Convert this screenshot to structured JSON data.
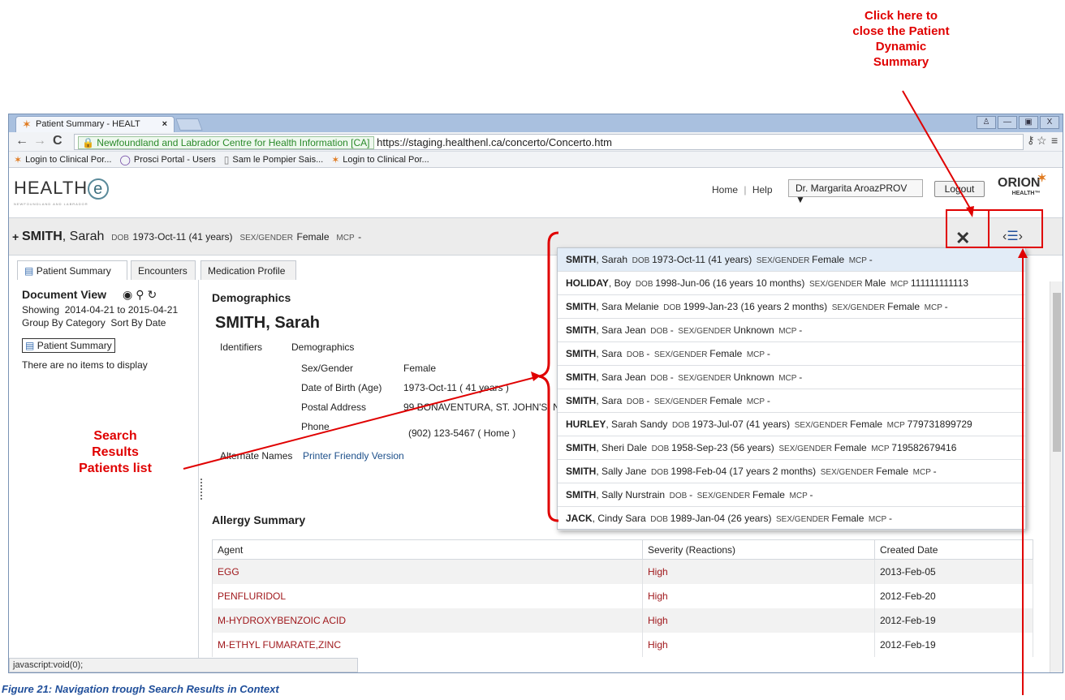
{
  "annotations": {
    "close_callout": "Click here to close the Patient Dynamic Summary",
    "close_callout_lines": [
      "Click here to",
      "close the Patient",
      "Dynamic",
      "Summary"
    ],
    "search_callout_lines": [
      "Search",
      "Results",
      "Patients list"
    ],
    "figure_caption": "Figure 21: Navigation trough Search Results in Context"
  },
  "browser": {
    "tab_title": "Patient Summary - HEALT",
    "tab_close": "×",
    "window_buttons": [
      "♙",
      "—",
      "▣",
      "X"
    ],
    "security_label": "Newfoundland and Labrador Centre for Health Information [CA]",
    "url": "https://staging.healthenl.ca/concerto/Concerto.htm",
    "bookmarks": [
      {
        "icon": "star-icon",
        "label": "Login to Clinical Por..."
      },
      {
        "icon": "circle-icon",
        "label": "Prosci Portal - Users"
      },
      {
        "icon": "page-icon",
        "label": "Sam le Pompier Sais..."
      },
      {
        "icon": "star-icon",
        "label": "Login to Clinical Por..."
      }
    ],
    "status_text": "javascript:void(0);"
  },
  "app": {
    "logo_text": "HEALTH",
    "logo_e": "e",
    "logo_sub": "NEWFOUNDLAND AND LABRADOR",
    "nav_home": "Home",
    "nav_sep": "|",
    "nav_help": "Help",
    "user": "Dr. Margarita AroazPROV ▼",
    "logout": "Logout",
    "orion": "ORION",
    "orion_sub": "HEALTH™"
  },
  "patient_bar": {
    "plus": "+",
    "surname": "SMITH",
    "given": ", Sarah",
    "dob_label": "DOB",
    "dob": "1973-Oct-11 (41 years)",
    "sex_label": "SEX/GENDER",
    "sex": "Female",
    "mcp_label": "MCP",
    "mcp": "-"
  },
  "tabs": [
    "Patient Summary",
    "Encounters",
    "Medication Profile"
  ],
  "sidebar": {
    "title": "Document View",
    "showing_label": "Showing",
    "showing_range": "2014-04-21 to 2015-04-21",
    "group_by_label": "Group By",
    "group_by": "Category",
    "sort_by_label": "Sort By",
    "sort_by": "Date",
    "selected_item": "Patient Summary",
    "empty_text": "There are no items to display"
  },
  "demographics": {
    "heading": "Demographics",
    "name": "SMITH, Sarah",
    "identifiers": "Identifiers",
    "demographics_col": "Demographics",
    "rows": [
      {
        "label": "Sex/Gender",
        "value": "Female"
      },
      {
        "label": "Date of Birth (Age)",
        "value": "1973-Oct-11 ( 41 years )"
      },
      {
        "label": "Postal Address",
        "value": "99 BONAVENTURA, ST. JOHN'S, NL"
      },
      {
        "label": "Phone",
        "value": "(902) 123-5467   ( Home )"
      }
    ],
    "alternate_names": "Alternate Names",
    "printer_friendly": "Printer Friendly Version"
  },
  "allergy": {
    "heading": "Allergy Summary",
    "columns": [
      "Agent",
      "Severity (Reactions)",
      "Created Date"
    ],
    "rows": [
      [
        "EGG",
        "High",
        "2013-Feb-05"
      ],
      [
        "PENFLURIDOL",
        "High",
        "2012-Feb-20"
      ],
      [
        "M-HYDROXYBENZOIC ACID",
        "High",
        "2012-Feb-19"
      ],
      [
        "M-ETHYL FUMARATE,ZINC",
        "High",
        "2012-Feb-19"
      ]
    ]
  },
  "search_results": [
    {
      "surname": "SMITH",
      "given": ", Sarah",
      "dob": "1973-Oct-11 (41 years)",
      "sex": "Female",
      "mcp": "-"
    },
    {
      "surname": "HOLIDAY",
      "given": ", Boy",
      "dob": "1998-Jun-06 (16 years 10 months)",
      "sex": "Male",
      "mcp": "111111111113"
    },
    {
      "surname": "SMITH",
      "given": ", Sara Melanie",
      "dob": "1999-Jan-23 (16 years 2 months)",
      "sex": "Female",
      "mcp": "-"
    },
    {
      "surname": "SMITH",
      "given": ", Sara Jean",
      "dob": "-",
      "sex": "Unknown",
      "mcp": "-"
    },
    {
      "surname": "SMITH",
      "given": ", Sara",
      "dob": "-",
      "sex": "Female",
      "mcp": "-"
    },
    {
      "surname": "SMITH",
      "given": ", Sara Jean",
      "dob": "-",
      "sex": "Unknown",
      "mcp": "-"
    },
    {
      "surname": "SMITH",
      "given": ", Sara",
      "dob": "-",
      "sex": "Female",
      "mcp": "-"
    },
    {
      "surname": "HURLEY",
      "given": ", Sarah Sandy",
      "dob": "1973-Jul-07 (41 years)",
      "sex": "Female",
      "mcp": "779731899729"
    },
    {
      "surname": "SMITH",
      "given": ", Sheri Dale",
      "dob": "1958-Sep-23 (56 years)",
      "sex": "Female",
      "mcp": "719582679416"
    },
    {
      "surname": "SMITH",
      "given": ", Sally Jane",
      "dob": "1998-Feb-04 (17 years 2 months)",
      "sex": "Female",
      "mcp": "-"
    },
    {
      "surname": "SMITH",
      "given": ", Sally Nurstrain",
      "dob": "-",
      "sex": "Female",
      "mcp": "-"
    },
    {
      "surname": "JACK",
      "given": ", Cindy Sara",
      "dob": "1989-Jan-04 (26 years)",
      "sex": "Female",
      "mcp": "-"
    }
  ],
  "colors": {
    "callout": "#e00000",
    "accent": "#1f4e9a",
    "danger": "#a0181c"
  }
}
